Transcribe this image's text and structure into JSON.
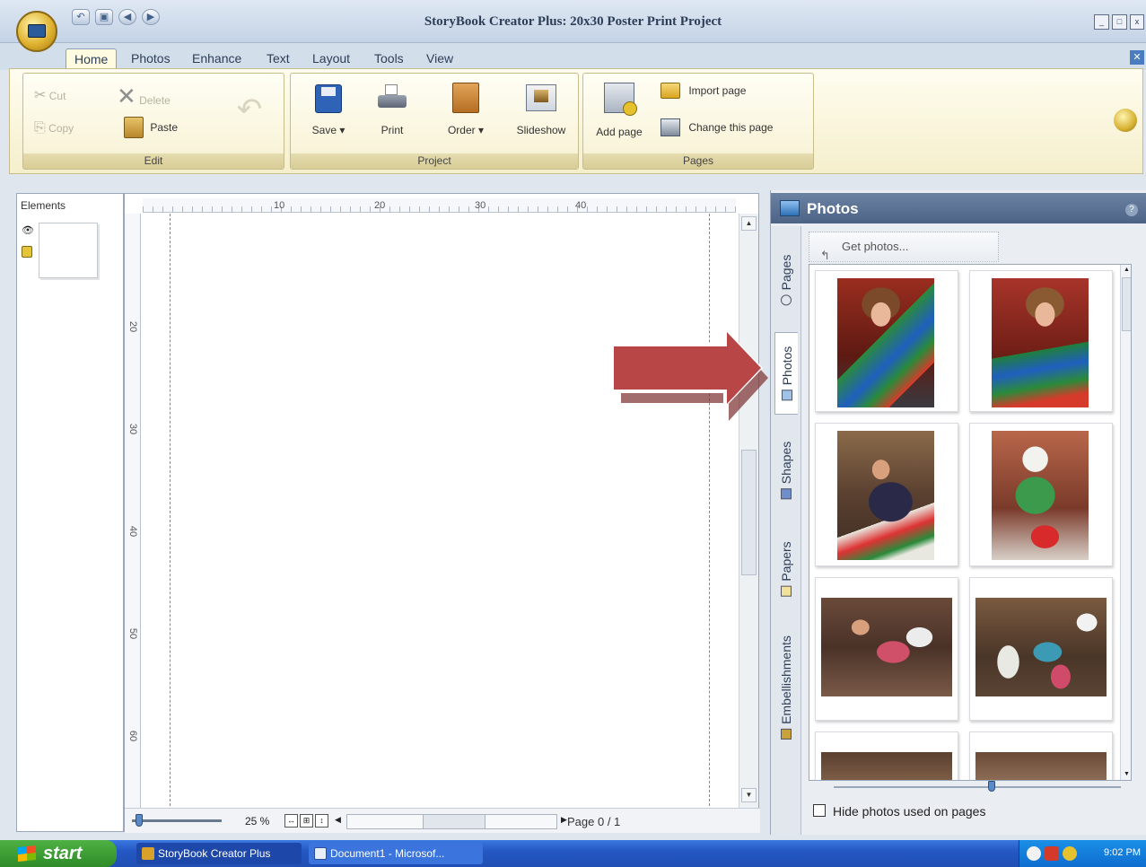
{
  "window": {
    "title": "StoryBook Creator Plus: 20x30 Poster Print Project"
  },
  "menu": {
    "tabs": [
      "Home",
      "Photos",
      "Enhance",
      "Text",
      "Layout",
      "Tools",
      "View"
    ],
    "active": "Home"
  },
  "ribbon": {
    "edit": {
      "label": "Edit",
      "cut": "Cut",
      "copy": "Copy",
      "delete": "Delete",
      "paste": "Paste"
    },
    "project": {
      "label": "Project",
      "save": "Save",
      "print": "Print",
      "order": "Order",
      "slideshow": "Slideshow"
    },
    "pages": {
      "label": "Pages",
      "add_page": "Add page",
      "import_page": "Import page",
      "change_page": "Change this page"
    }
  },
  "elements_panel": {
    "title": "Elements"
  },
  "canvas": {
    "ruler_top": [
      "10",
      "20",
      "30",
      "40"
    ],
    "ruler_left": [
      "20",
      "30",
      "40",
      "50",
      "60"
    ],
    "zoom": "25 %",
    "page_indicator": "Page 0 / 1"
  },
  "photos_panel": {
    "title": "Photos",
    "tabs": [
      "Pages",
      "Photos",
      "Shapes",
      "Papers",
      "Embellishments"
    ],
    "active_tab": "Photos",
    "get_photos": "Get photos...",
    "hide_used": "Hide photos used on pages",
    "photos": [
      {
        "name": "girl-with-gift-1"
      },
      {
        "name": "girl-with-gift-2"
      },
      {
        "name": "man-with-gift-bag"
      },
      {
        "name": "baby-with-toy"
      },
      {
        "name": "kids-playing"
      },
      {
        "name": "family-with-gift"
      },
      {
        "name": "partial-photo-1"
      },
      {
        "name": "partial-photo-2"
      }
    ]
  },
  "taskbar": {
    "start": "start",
    "items": [
      "StoryBook Creator Plus",
      "Document1 - Microsof..."
    ],
    "clock": "9:02 PM"
  },
  "colors": {
    "arrow": "#b94646",
    "ribbon_bg": "#fbf6dc",
    "panel_header": "#5a7194",
    "taskbar": "#2558c4"
  }
}
